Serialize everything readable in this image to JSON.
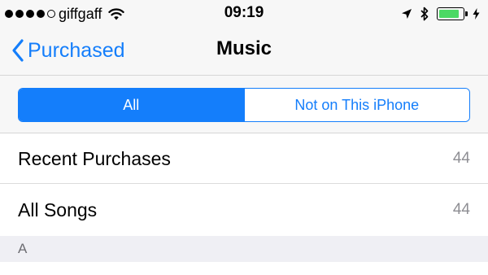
{
  "status_bar": {
    "signal_bars_filled": 4,
    "signal_bars_total": 5,
    "carrier": "giffgaff",
    "time": "09:19",
    "icons": [
      "signal-dots-icon",
      "wifi-icon",
      "location-arrow-icon",
      "bluetooth-icon",
      "battery-icon",
      "charging-bolt-icon"
    ],
    "battery_level": 0.85,
    "battery_color": "#4cd964"
  },
  "nav": {
    "back_label": "Purchased",
    "title": "Music"
  },
  "segmented": {
    "options": [
      "All",
      "Not on This iPhone"
    ],
    "selected_index": 0
  },
  "rows": [
    {
      "label": "Recent Purchases",
      "count": "44"
    },
    {
      "label": "All Songs",
      "count": "44"
    }
  ],
  "section_header": "A",
  "colors": {
    "accent": "#147efb",
    "bar_background": "#f7f7f7",
    "section_background": "#efeff4"
  }
}
